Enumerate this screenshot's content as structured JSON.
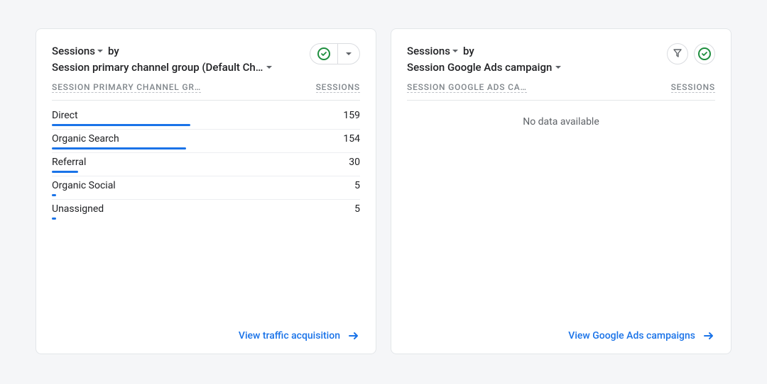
{
  "cards": {
    "traffic": {
      "metric_label": "Sessions",
      "by_label": "by",
      "dimension_label": "Session primary channel group (Default Ch…",
      "column_dimension": "SESSION PRIMARY CHANNEL GR…",
      "column_metric": "SESSIONS",
      "footer_label": "View traffic acquisition"
    },
    "ads": {
      "metric_label": "Sessions",
      "by_label": "by",
      "dimension_label": "Session Google Ads campaign",
      "column_dimension": "SESSION GOOGLE ADS CA…",
      "column_metric": "SESSIONS",
      "no_data": "No data available",
      "footer_label": "View Google Ads campaigns"
    }
  },
  "chart_data": {
    "type": "bar",
    "title": "Sessions by Session primary channel group",
    "xlabel": "Session primary channel group",
    "ylabel": "Sessions",
    "categories": [
      "Direct",
      "Organic Search",
      "Referral",
      "Organic Social",
      "Unassigned"
    ],
    "values": [
      159,
      154,
      30,
      5,
      5
    ],
    "ylim": [
      0,
      353
    ]
  },
  "colors": {
    "accent_blue": "#1a73e8",
    "green": "#1e8e3e"
  }
}
